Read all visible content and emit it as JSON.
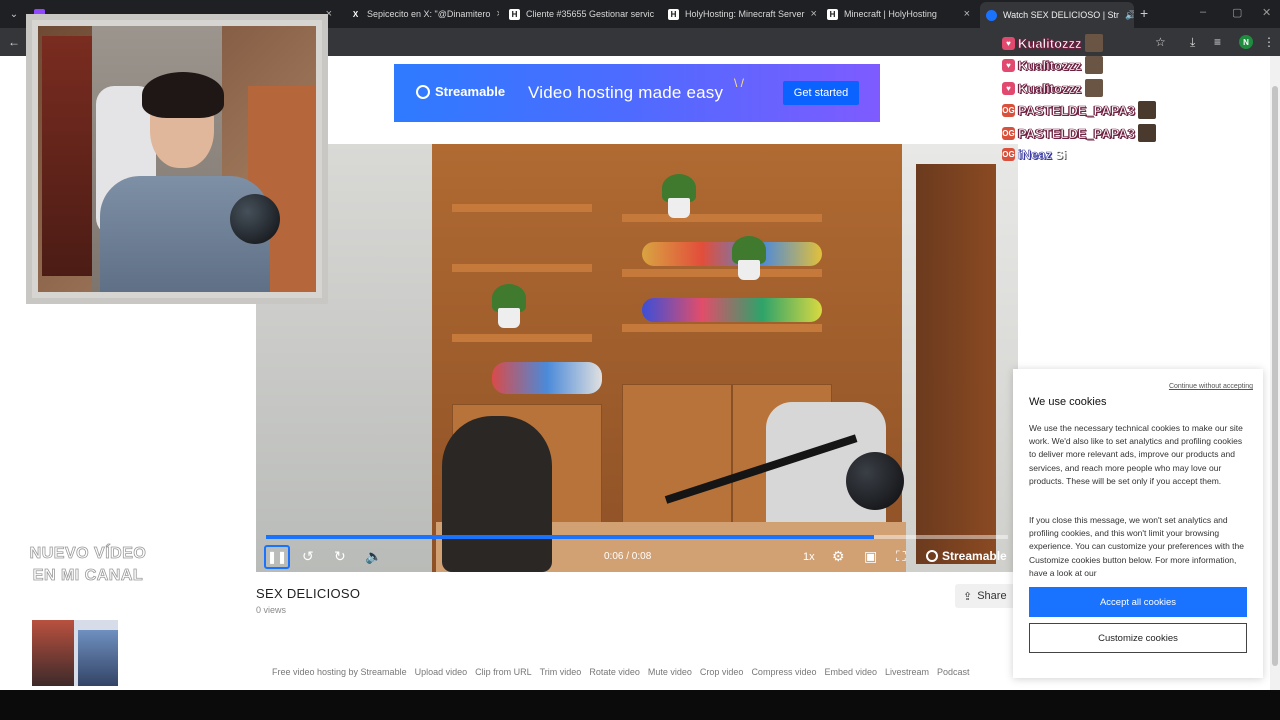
{
  "browser": {
    "tabs": [
      {
        "title": "",
        "favicon": "twitch-icon"
      },
      {
        "title": "Sepicecito en X: \"@Dinamitero",
        "favicon": "x-logo-icon"
      },
      {
        "title": "Cliente #35655 Gestionar servic",
        "favicon": "holyhosting-icon"
      },
      {
        "title": "HolyHosting: Minecraft Server",
        "favicon": "holyhosting-icon"
      },
      {
        "title": "Minecraft | HolyHosting",
        "favicon": "holyhosting-icon"
      },
      {
        "title": "Watch SEX DELICIOSO | Str",
        "favicon": "streamable-icon",
        "active": true
      }
    ],
    "profile_initial": "N"
  },
  "banner": {
    "brand": "Streamable",
    "headline": "Video hosting made easy",
    "cta": "Get started"
  },
  "player": {
    "time": "0:06 / 0:08",
    "speed": "1x",
    "brand": "Streamable",
    "progress": 0.82
  },
  "video": {
    "title": "SEX DELICIOSO",
    "views": "0 views",
    "share_label": "Share"
  },
  "footer": {
    "links": [
      "Free video hosting by Streamable",
      "Upload video",
      "Clip from URL",
      "Trim video",
      "Rotate video",
      "Mute video",
      "Crop video",
      "Compress video",
      "Embed video",
      "Livestream",
      "Podcast"
    ]
  },
  "chat": [
    {
      "name": "Kualitozzz",
      "badge": "heart"
    },
    {
      "name": "Kualitozzz",
      "badge": "heart"
    },
    {
      "name": "Kualitozzz",
      "badge": "heart"
    },
    {
      "name": "PASTELDE_PAPA3",
      "badge": "og"
    },
    {
      "name": "PASTELDE_PAPA3",
      "badge": "og"
    },
    {
      "name": "iNeaz",
      "badge": "og",
      "message": "Si"
    }
  ],
  "promo": {
    "line1": "NUEVO VÍDEO",
    "line2": "EN MI CANAL"
  },
  "cookies": {
    "skip": "Continue without accepting",
    "title": "We use cookies",
    "paragraph1": "We use the necessary technical cookies to make our site work. We'd also like to set analytics and profiling cookies to deliver more relevant ads, improve our products and services, and reach more people who may love our products. These will be set only if you accept them.",
    "paragraph2": "If you close this message, we won't set analytics and profiling cookies, and this won't limit your browsing experience. You can customize your preferences with the Customize cookies button below. For more information, have a look at our",
    "accept": "Accept all cookies",
    "customize": "Customize cookies"
  },
  "colors": {
    "accent": "#1a73ff",
    "chrome_dark": "#1f2023",
    "chrome_toolbar": "#35363a"
  }
}
